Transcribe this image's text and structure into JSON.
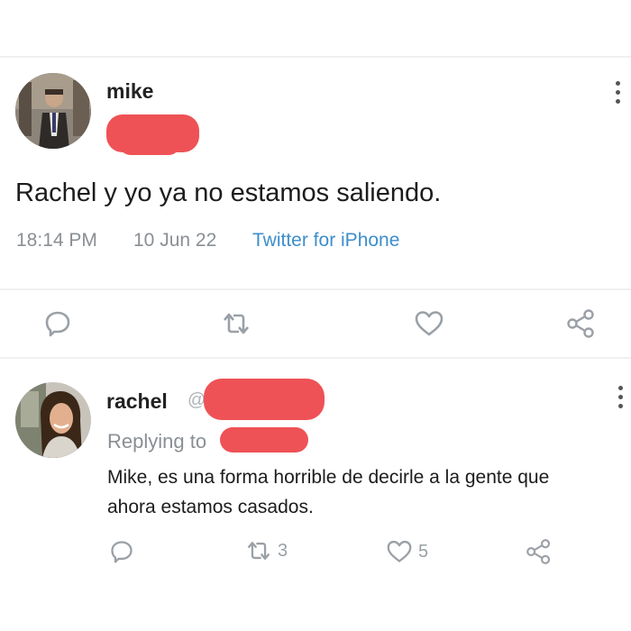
{
  "tweet": {
    "author_name": "mike",
    "text": "Rachel y yo ya no estamos saliendo.",
    "time": "18:14 PM",
    "date": "10 Jun 22",
    "source": "Twitter for iPhone"
  },
  "reply": {
    "author_name": "rachel",
    "handle_prefix": "@",
    "replying_label": "Replying to",
    "text_line1": "Mike, es una forma horrible de decirle a la gente que",
    "text_line2": "ahora estamos casados.",
    "retweet_count": "3",
    "like_count": "5"
  },
  "colors": {
    "redaction": "#ee5256",
    "source_link": "#3d8ecb",
    "meta_text": "#8a8f94",
    "icon": "#9aa0a6"
  },
  "icons": [
    "reply-icon",
    "retweet-icon",
    "like-icon",
    "share-icon",
    "more-options-icon"
  ]
}
